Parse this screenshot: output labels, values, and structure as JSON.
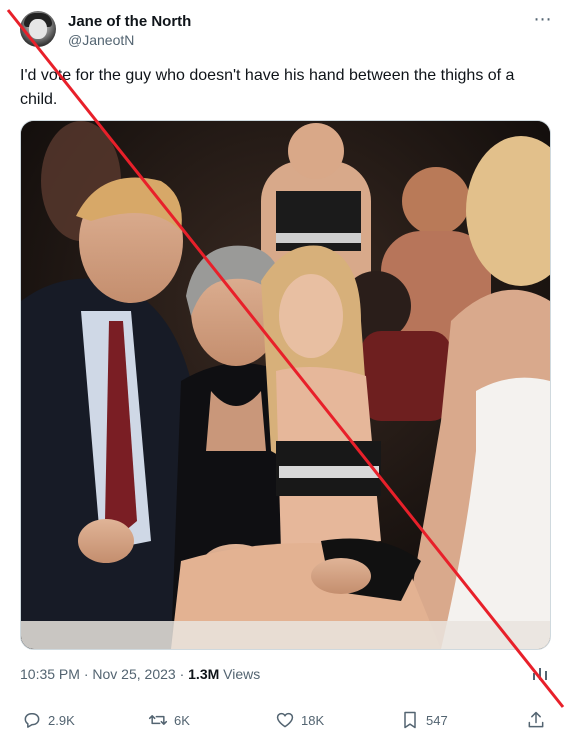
{
  "author": {
    "name": "Jane of the North",
    "handle": "@JaneotN"
  },
  "tweet": {
    "text": "I'd vote for the guy who doesn't have his hand between the thighs of a child."
  },
  "meta": {
    "time": "10:35 PM",
    "separator1": " · ",
    "date": "Nov 25, 2023",
    "separator2": " · ",
    "views_count": "1.3M",
    "views_label": " Views"
  },
  "actions": {
    "replies": "2.9K",
    "reposts": "6K",
    "likes": "18K",
    "bookmarks": "547"
  },
  "more_icon": "⋯",
  "colors": {
    "cross_line": "#e8202a",
    "secondary_text": "#536471"
  }
}
